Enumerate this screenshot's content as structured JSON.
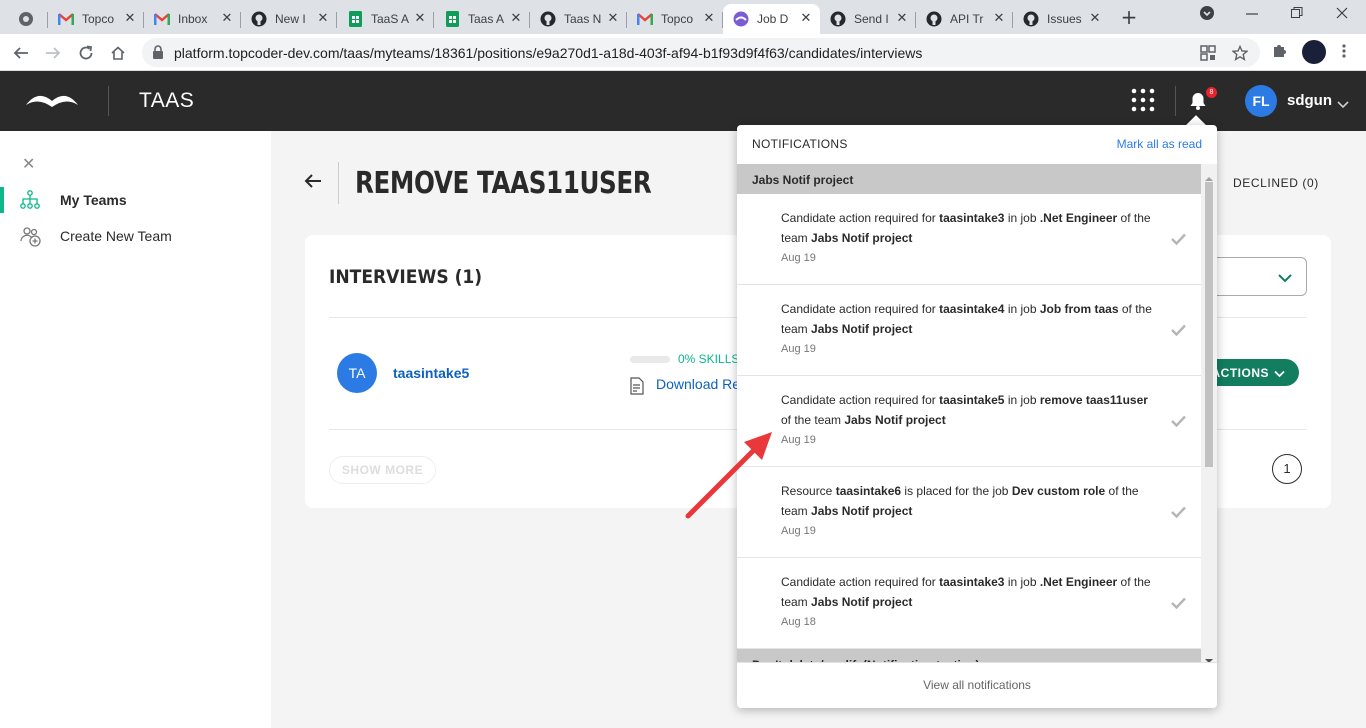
{
  "browser": {
    "tabs": [
      {
        "title": "",
        "icon": "chrome-icon"
      },
      {
        "title": "Topco",
        "icon": "gmail-icon"
      },
      {
        "title": "Inbox",
        "icon": "gmail-icon"
      },
      {
        "title": "New I",
        "icon": "github-icon"
      },
      {
        "title": "TaaS A",
        "icon": "sheets-icon"
      },
      {
        "title": "Taas A",
        "icon": "sheets-icon"
      },
      {
        "title": "Taas N",
        "icon": "github-icon"
      },
      {
        "title": "Topco",
        "icon": "gmail-icon"
      },
      {
        "title": "Job D",
        "icon": "taas-icon",
        "active": true
      },
      {
        "title": "Send I",
        "icon": "github-icon"
      },
      {
        "title": "API Tr",
        "icon": "github-icon"
      },
      {
        "title": "Issues",
        "icon": "github-icon"
      }
    ],
    "url": "platform.topcoder-dev.com/taas/myteams/18361/positions/e9a270d1-a18d-403f-af94-b1f93d9f4f63/candidates/interviews"
  },
  "header": {
    "app_title": "TAAS",
    "notification_count": "8",
    "user_initials": "FL",
    "user_name": "sdgun"
  },
  "sidebar": {
    "items": [
      {
        "label": "My Teams",
        "active": true
      },
      {
        "label": "Create New Team",
        "active": false
      }
    ]
  },
  "main": {
    "page_title": "REMOVE TAAS11USER",
    "declined_tab": "DECLINED (0)",
    "section_title": "INTERVIEWS (1)",
    "candidate": {
      "initials": "TA",
      "name": "taasintake5",
      "skills": "0% SKILLS",
      "download": "Download Re",
      "actions": "ACTIONS"
    },
    "show_more": "SHOW MORE",
    "page": "1"
  },
  "notifications": {
    "title": "NOTIFICATIONS",
    "mark_all": "Mark all as read",
    "groups": [
      {
        "name": "Jabs Notif project"
      },
      {
        "name": "Don't delete/modify(Notification testing)"
      }
    ],
    "items": [
      {
        "parts": [
          "Candidate action required for ",
          "taasintake3",
          " in job ",
          ".Net Engineer",
          " of the team ",
          "Jabs Notif project"
        ],
        "date": "Aug 19"
      },
      {
        "parts": [
          "Candidate action required for ",
          "taasintake4",
          " in job ",
          "Job from taas",
          " of the team ",
          "Jabs Notif project"
        ],
        "date": "Aug 19"
      },
      {
        "parts": [
          "Candidate action required for ",
          "taasintake5",
          " in job ",
          "remove taas11user",
          " of the team ",
          "Jabs Notif project"
        ],
        "date": "Aug 19"
      },
      {
        "parts": [
          "Resource ",
          "taasintake6",
          " is placed for the job ",
          "Dev custom role",
          " of the team ",
          "Jabs Notif project"
        ],
        "date": "Aug 19"
      },
      {
        "parts": [
          "Candidate action required for ",
          "taasintake3",
          " in job ",
          ".Net Engineer",
          " of the team ",
          "Jabs Notif project"
        ],
        "date": "Aug 18"
      }
    ],
    "view_all": "View all notifications"
  },
  "colors": {
    "accent_green": "#0ab88a",
    "action_green": "#137d60",
    "link_blue": "#0d61bf",
    "avatar_blue": "#2c7be5",
    "badge_red": "#e9232b",
    "annotation_arrow": "#e8383a"
  }
}
